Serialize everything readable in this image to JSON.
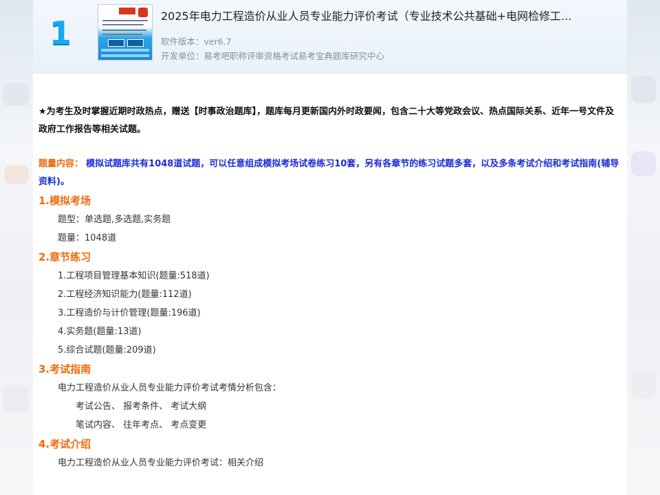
{
  "product": {
    "rank": "1",
    "title": "2025年电力工程造价从业人员专业能力评价考试（专业技术公共基础+电网检修工...",
    "version": "软件版本：ver6.7",
    "developer": "开发单位：易考吧职称评审资格考试易考宝典题库研究中心"
  },
  "notice": "★为考生及时掌握近期时政热点，赠送【时事政治题库】，题库每月更新国内外时政要闻，包含二十大等党政会议、热点国际关系、近年一号文件及政府工作报告等相关试题。",
  "intro": {
    "label": "题量内容：",
    "text": "模拟试题库共有1048道试题，可以任意组成模拟考场试卷练习10套，另有各章节的练习试题多套，以及多条考试介绍和考试指南(辅导资料)。"
  },
  "sections": {
    "mock": {
      "title": "1.模拟考场",
      "items": [
        "题型：单选题,多选题,实务题",
        "题量：1048道"
      ]
    },
    "chapters": {
      "title": "2.章节练习",
      "items": [
        "1.工程项目管理基本知识(题量:518道)",
        "2.工程经济知识能力(题量:112道)",
        "3.工程造价与计价管理(题量:196道)",
        "4.实务题(题量:13道)",
        "5.综合试题(题量:209道)"
      ]
    },
    "guide": {
      "title": "3.考试指南",
      "lead": "电力工程造价从业人员专业能力评价考试考情分析包含：",
      "rows": [
        "考试公告、 报考条件、 考试大纲",
        "笔试内容、 往年考点、 考点变更"
      ]
    },
    "about": {
      "title": "4.考试介绍",
      "lead": "电力工程造价从业人员专业能力评价考试：相关介绍"
    }
  }
}
